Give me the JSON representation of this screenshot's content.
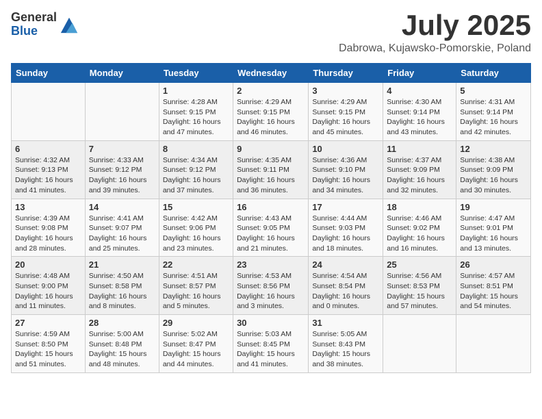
{
  "logo": {
    "general": "General",
    "blue": "Blue"
  },
  "title": "July 2025",
  "subtitle": "Dabrowa, Kujawsko-Pomorskie, Poland",
  "headers": [
    "Sunday",
    "Monday",
    "Tuesday",
    "Wednesday",
    "Thursday",
    "Friday",
    "Saturday"
  ],
  "weeks": [
    [
      {
        "day": "",
        "info": ""
      },
      {
        "day": "",
        "info": ""
      },
      {
        "day": "1",
        "info": "Sunrise: 4:28 AM\nSunset: 9:15 PM\nDaylight: 16 hours and 47 minutes."
      },
      {
        "day": "2",
        "info": "Sunrise: 4:29 AM\nSunset: 9:15 PM\nDaylight: 16 hours and 46 minutes."
      },
      {
        "day": "3",
        "info": "Sunrise: 4:29 AM\nSunset: 9:15 PM\nDaylight: 16 hours and 45 minutes."
      },
      {
        "day": "4",
        "info": "Sunrise: 4:30 AM\nSunset: 9:14 PM\nDaylight: 16 hours and 43 minutes."
      },
      {
        "day": "5",
        "info": "Sunrise: 4:31 AM\nSunset: 9:14 PM\nDaylight: 16 hours and 42 minutes."
      }
    ],
    [
      {
        "day": "6",
        "info": "Sunrise: 4:32 AM\nSunset: 9:13 PM\nDaylight: 16 hours and 41 minutes."
      },
      {
        "day": "7",
        "info": "Sunrise: 4:33 AM\nSunset: 9:12 PM\nDaylight: 16 hours and 39 minutes."
      },
      {
        "day": "8",
        "info": "Sunrise: 4:34 AM\nSunset: 9:12 PM\nDaylight: 16 hours and 37 minutes."
      },
      {
        "day": "9",
        "info": "Sunrise: 4:35 AM\nSunset: 9:11 PM\nDaylight: 16 hours and 36 minutes."
      },
      {
        "day": "10",
        "info": "Sunrise: 4:36 AM\nSunset: 9:10 PM\nDaylight: 16 hours and 34 minutes."
      },
      {
        "day": "11",
        "info": "Sunrise: 4:37 AM\nSunset: 9:09 PM\nDaylight: 16 hours and 32 minutes."
      },
      {
        "day": "12",
        "info": "Sunrise: 4:38 AM\nSunset: 9:09 PM\nDaylight: 16 hours and 30 minutes."
      }
    ],
    [
      {
        "day": "13",
        "info": "Sunrise: 4:39 AM\nSunset: 9:08 PM\nDaylight: 16 hours and 28 minutes."
      },
      {
        "day": "14",
        "info": "Sunrise: 4:41 AM\nSunset: 9:07 PM\nDaylight: 16 hours and 25 minutes."
      },
      {
        "day": "15",
        "info": "Sunrise: 4:42 AM\nSunset: 9:06 PM\nDaylight: 16 hours and 23 minutes."
      },
      {
        "day": "16",
        "info": "Sunrise: 4:43 AM\nSunset: 9:05 PM\nDaylight: 16 hours and 21 minutes."
      },
      {
        "day": "17",
        "info": "Sunrise: 4:44 AM\nSunset: 9:03 PM\nDaylight: 16 hours and 18 minutes."
      },
      {
        "day": "18",
        "info": "Sunrise: 4:46 AM\nSunset: 9:02 PM\nDaylight: 16 hours and 16 minutes."
      },
      {
        "day": "19",
        "info": "Sunrise: 4:47 AM\nSunset: 9:01 PM\nDaylight: 16 hours and 13 minutes."
      }
    ],
    [
      {
        "day": "20",
        "info": "Sunrise: 4:48 AM\nSunset: 9:00 PM\nDaylight: 16 hours and 11 minutes."
      },
      {
        "day": "21",
        "info": "Sunrise: 4:50 AM\nSunset: 8:58 PM\nDaylight: 16 hours and 8 minutes."
      },
      {
        "day": "22",
        "info": "Sunrise: 4:51 AM\nSunset: 8:57 PM\nDaylight: 16 hours and 5 minutes."
      },
      {
        "day": "23",
        "info": "Sunrise: 4:53 AM\nSunset: 8:56 PM\nDaylight: 16 hours and 3 minutes."
      },
      {
        "day": "24",
        "info": "Sunrise: 4:54 AM\nSunset: 8:54 PM\nDaylight: 16 hours and 0 minutes."
      },
      {
        "day": "25",
        "info": "Sunrise: 4:56 AM\nSunset: 8:53 PM\nDaylight: 15 hours and 57 minutes."
      },
      {
        "day": "26",
        "info": "Sunrise: 4:57 AM\nSunset: 8:51 PM\nDaylight: 15 hours and 54 minutes."
      }
    ],
    [
      {
        "day": "27",
        "info": "Sunrise: 4:59 AM\nSunset: 8:50 PM\nDaylight: 15 hours and 51 minutes."
      },
      {
        "day": "28",
        "info": "Sunrise: 5:00 AM\nSunset: 8:48 PM\nDaylight: 15 hours and 48 minutes."
      },
      {
        "day": "29",
        "info": "Sunrise: 5:02 AM\nSunset: 8:47 PM\nDaylight: 15 hours and 44 minutes."
      },
      {
        "day": "30",
        "info": "Sunrise: 5:03 AM\nSunset: 8:45 PM\nDaylight: 15 hours and 41 minutes."
      },
      {
        "day": "31",
        "info": "Sunrise: 5:05 AM\nSunset: 8:43 PM\nDaylight: 15 hours and 38 minutes."
      },
      {
        "day": "",
        "info": ""
      },
      {
        "day": "",
        "info": ""
      }
    ]
  ]
}
